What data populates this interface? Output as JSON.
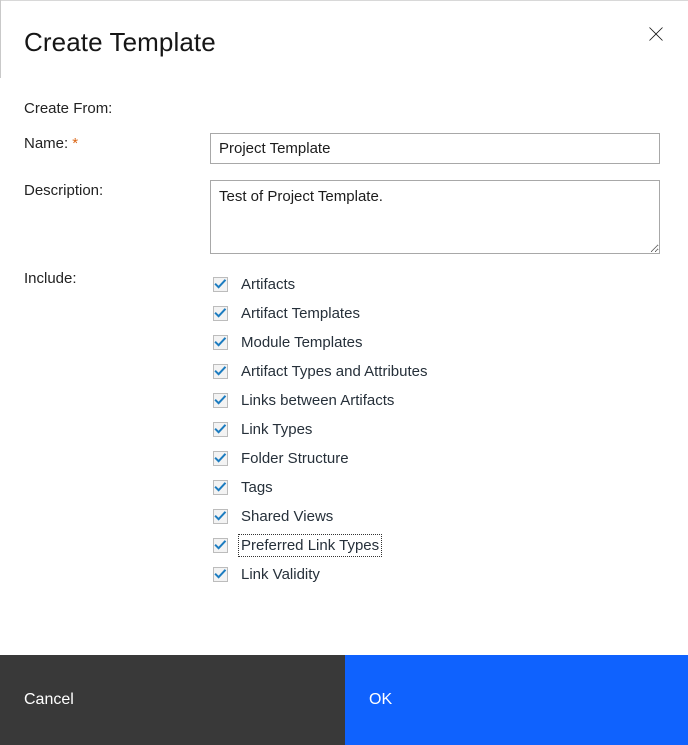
{
  "dialog": {
    "title": "Create Template",
    "close_icon": "close-icon"
  },
  "form": {
    "create_from": {
      "label": "Create From:",
      "value": ""
    },
    "name": {
      "label": "Name:",
      "required_marker": "*",
      "value": "Project Template",
      "placeholder": ""
    },
    "description": {
      "label": "Description:",
      "value": "Test of Project Template.",
      "placeholder": ""
    },
    "include": {
      "label": "Include:",
      "items": [
        {
          "label": "Artifacts",
          "checked": true,
          "focused": false
        },
        {
          "label": "Artifact Templates",
          "checked": true,
          "focused": false
        },
        {
          "label": "Module Templates",
          "checked": true,
          "focused": false
        },
        {
          "label": "Artifact Types and Attributes",
          "checked": true,
          "focused": false
        },
        {
          "label": "Links between Artifacts",
          "checked": true,
          "focused": false
        },
        {
          "label": "Link Types",
          "checked": true,
          "focused": false
        },
        {
          "label": "Folder Structure",
          "checked": true,
          "focused": false
        },
        {
          "label": "Tags",
          "checked": true,
          "focused": false
        },
        {
          "label": "Shared Views",
          "checked": true,
          "focused": false
        },
        {
          "label": "Preferred Link Types",
          "checked": true,
          "focused": true
        },
        {
          "label": "Link Validity",
          "checked": true,
          "focused": false
        }
      ]
    }
  },
  "footer": {
    "cancel_label": "Cancel",
    "ok_label": "OK"
  },
  "colors": {
    "primary_button": "#0f62fe",
    "secondary_button": "#393939",
    "required_star": "#da6413",
    "checkmark": "#1c7cc0",
    "text": "#161616"
  }
}
